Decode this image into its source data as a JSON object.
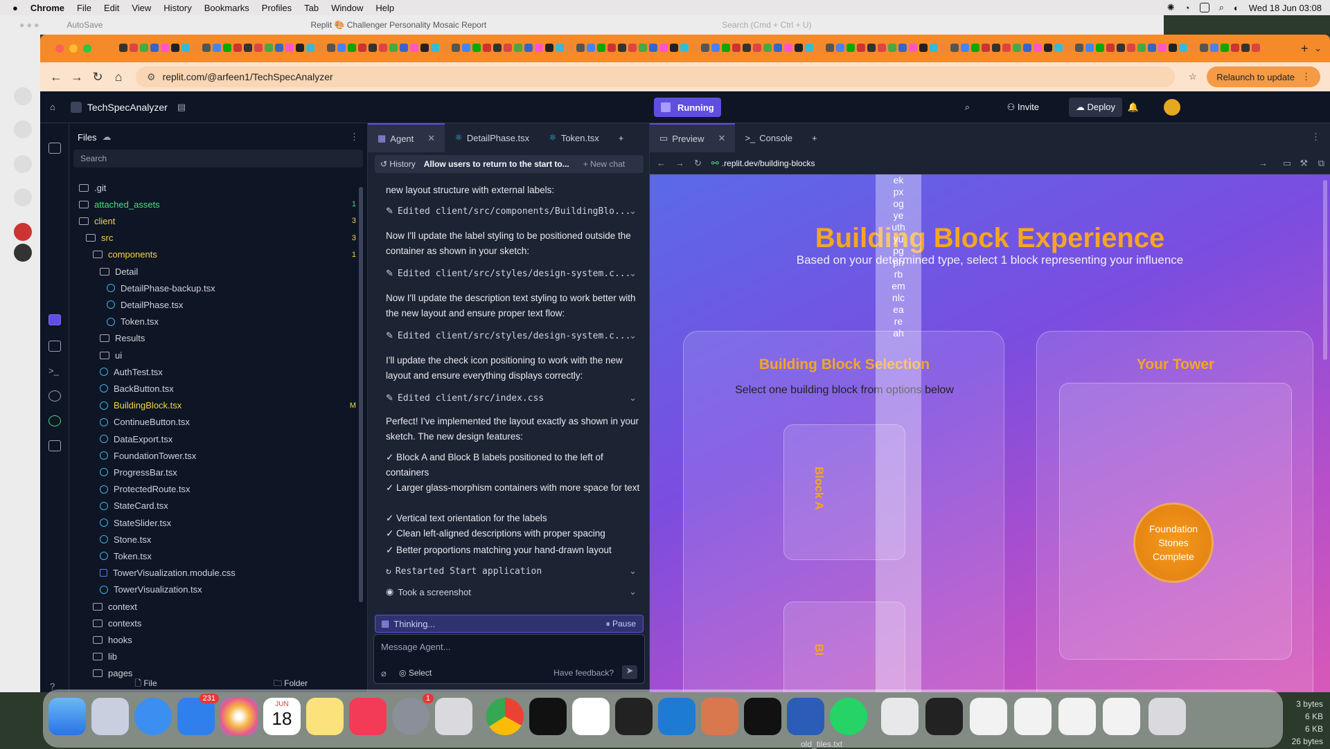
{
  "menubar": {
    "apple": "",
    "app": "Chrome",
    "items": [
      "File",
      "Edit",
      "View",
      "History",
      "Bookmarks",
      "Profiles",
      "Tab",
      "Window",
      "Help"
    ],
    "clock": "Wed 18 Jun  03:08"
  },
  "wordbar": {
    "autosave": "AutoSave",
    "doc_title": "Replit  🎨 Challenger Personality Mosaic Report",
    "search_placeholder": "Search (Cmd + Ctrl + U)"
  },
  "browser": {
    "url": "replit.com/@arfeen1/TechSpecAnalyzer",
    "relaunch": "Relaunch to update"
  },
  "replit": {
    "project": "TechSpecAnalyzer",
    "status": "Running",
    "invite": "Invite",
    "deploy": "Deploy"
  },
  "files": {
    "header": "Files",
    "search_placeholder": "Search",
    "tree": [
      {
        "name": ".git",
        "type": "folder",
        "indent": 0,
        "badge": ""
      },
      {
        "name": "attached_assets",
        "type": "folder",
        "indent": 0,
        "badge": "1",
        "color": "#4ade80"
      },
      {
        "name": "client",
        "type": "folder",
        "indent": 0,
        "badge": "3",
        "color": "#f5d547"
      },
      {
        "name": "src",
        "type": "folder",
        "indent": 1,
        "badge": "3",
        "color": "#f5d547"
      },
      {
        "name": "components",
        "type": "folder",
        "indent": 2,
        "badge": "1",
        "color": "#f5d547"
      },
      {
        "name": "Detail",
        "type": "folder",
        "indent": 3,
        "badge": ""
      },
      {
        "name": "DetailPhase-backup.tsx",
        "type": "react",
        "indent": 4,
        "badge": ""
      },
      {
        "name": "DetailPhase.tsx",
        "type": "react",
        "indent": 4,
        "badge": ""
      },
      {
        "name": "Token.tsx",
        "type": "react",
        "indent": 4,
        "badge": ""
      },
      {
        "name": "Results",
        "type": "folder",
        "indent": 3,
        "badge": ""
      },
      {
        "name": "ui",
        "type": "folder",
        "indent": 3,
        "badge": ""
      },
      {
        "name": "AuthTest.tsx",
        "type": "react",
        "indent": 3,
        "badge": ""
      },
      {
        "name": "BackButton.tsx",
        "type": "react",
        "indent": 3,
        "badge": ""
      },
      {
        "name": "BuildingBlock.tsx",
        "type": "react",
        "indent": 3,
        "badge": "M",
        "color": "#f5d547"
      },
      {
        "name": "ContinueButton.tsx",
        "type": "react",
        "indent": 3,
        "badge": ""
      },
      {
        "name": "DataExport.tsx",
        "type": "react",
        "indent": 3,
        "badge": ""
      },
      {
        "name": "FoundationTower.tsx",
        "type": "react",
        "indent": 3,
        "badge": ""
      },
      {
        "name": "ProgressBar.tsx",
        "type": "react",
        "indent": 3,
        "badge": ""
      },
      {
        "name": "ProtectedRoute.tsx",
        "type": "react",
        "indent": 3,
        "badge": ""
      },
      {
        "name": "StateCard.tsx",
        "type": "react",
        "indent": 3,
        "badge": ""
      },
      {
        "name": "StateSlider.tsx",
        "type": "react",
        "indent": 3,
        "badge": ""
      },
      {
        "name": "Stone.tsx",
        "type": "react",
        "indent": 3,
        "badge": ""
      },
      {
        "name": "Token.tsx",
        "type": "react",
        "indent": 3,
        "badge": ""
      },
      {
        "name": "TowerVisualization.module.css",
        "type": "css",
        "indent": 3,
        "badge": ""
      },
      {
        "name": "TowerVisualization.tsx",
        "type": "react",
        "indent": 3,
        "badge": ""
      },
      {
        "name": "context",
        "type": "folder",
        "indent": 2,
        "badge": ""
      },
      {
        "name": "contexts",
        "type": "folder",
        "indent": 2,
        "badge": ""
      },
      {
        "name": "hooks",
        "type": "folder",
        "indent": 2,
        "badge": ""
      },
      {
        "name": "lib",
        "type": "folder",
        "indent": 2,
        "badge": ""
      },
      {
        "name": "pages",
        "type": "folder",
        "indent": 2,
        "badge": ""
      }
    ],
    "new_file": "File",
    "new_folder": "Folder"
  },
  "agent": {
    "tabs": [
      "Agent",
      "DetailPhase.tsx",
      "Token.tsx"
    ],
    "history": "History",
    "thread_title": "Allow users to return to the start to...",
    "new_chat": "New chat",
    "msg0": "new layout structure with external labels:",
    "edit1": "Edited client/src/components/BuildingBlo...",
    "msg1": "Now I'll update the label styling to be positioned outside the container as shown in your sketch:",
    "edit2": "Edited client/src/styles/design-system.c...",
    "msg2": "Now I'll update the description text styling to work better with the new layout and ensure proper text flow:",
    "edit3": "Edited client/src/styles/design-system.c...",
    "msg3": "I'll update the check icon positioning to work with the new layout and ensure everything displays correctly:",
    "edit4": "Edited client/src/index.css",
    "msg4": "Perfect! I've implemented the layout exactly as shown in your sketch. The new design features:",
    "bullets": [
      "✓ Block A and Block B labels positioned to the left of containers",
      "✓ Larger glass-morphism containers with more space for text",
      "✓ Vertical text orientation for the labels",
      "✓ Clean left-aligned descriptions with proper spacing",
      "✓ Better proportions matching your hand-drawn layout"
    ],
    "restart": "Restarted Start application",
    "screenshot": "Took a screenshot",
    "thinking": "Thinking...",
    "pause": "Pause",
    "input_placeholder": "Message Agent...",
    "select": "Select",
    "feedback": "Have feedback?"
  },
  "preview": {
    "tabs": [
      "Preview",
      "Console"
    ],
    "url": ".replit.dev/building-blocks",
    "title": "Building Block Experience",
    "subtitle": "Based on your determined type, select 1 block representing your influence",
    "left_title": "Building Block Selection",
    "left_sub": "Select one building block from options below",
    "block_a": "Block A",
    "block_b": "Bl",
    "right_title": "Your Tower",
    "stone": "Foundation Stones Complete",
    "overlay_text": "ekpxogyeuth yupgphrbemnlceareah"
  },
  "dock": {
    "mail_badge": "231",
    "settings_badge": "1",
    "cal_month": "JUN",
    "cal_day": "18",
    "sizes": [
      "3 bytes",
      "6 KB",
      "6 KB",
      "26 bytes"
    ],
    "filename": "old_tiles.txt"
  }
}
